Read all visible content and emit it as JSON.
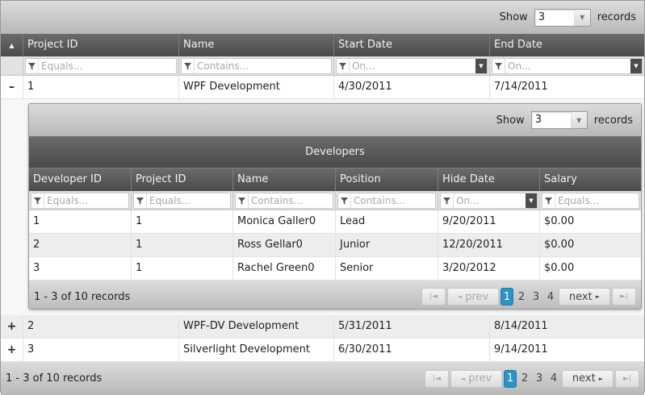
{
  "top_bar": {
    "show_label": "Show",
    "page_size": "3",
    "records_label": "records"
  },
  "columns": [
    "Project ID",
    "Name",
    "Start Date",
    "End Date"
  ],
  "filters": [
    "Equals...",
    "Contains...",
    "On...",
    "On..."
  ],
  "rows": [
    {
      "toggle": "–",
      "id": "1",
      "name": "WPF Development",
      "start": "4/30/2011",
      "end": "7/14/2011"
    },
    {
      "toggle": "+",
      "id": "2",
      "name": "WPF-DV Development",
      "start": "5/31/2011",
      "end": "8/14/2011"
    },
    {
      "toggle": "+",
      "id": "3",
      "name": "Silverlight Development",
      "start": "6/30/2011",
      "end": "9/14/2011"
    }
  ],
  "detail": {
    "show_label": "Show",
    "page_size": "3",
    "records_label": "records",
    "group_title": "Developers",
    "columns": [
      "Developer ID",
      "Project ID",
      "Name",
      "Position",
      "Hide Date",
      "Salary"
    ],
    "filters": [
      "Equals...",
      "Equals...",
      "Contains...",
      "Contains...",
      "On...",
      "Equals..."
    ],
    "rows": [
      [
        "1",
        "1",
        "Monica Galler0",
        "Lead",
        "9/20/2011",
        "$0.00"
      ],
      [
        "2",
        "1",
        "Ross Gellar0",
        "Junior",
        "12/20/2011",
        "$0.00"
      ],
      [
        "3",
        "1",
        "Rachel Green0",
        "Senior",
        "3/20/2012",
        "$0.00"
      ]
    ],
    "pager": {
      "summary": "1 - 3 of 10 records",
      "prev": "prev",
      "next": "next",
      "pages": [
        "1",
        "2",
        "3",
        "4"
      ],
      "active": "1"
    }
  },
  "pager": {
    "summary": "1 - 3 of 10 records",
    "prev": "prev",
    "next": "next",
    "pages": [
      "1",
      "2",
      "3",
      "4"
    ],
    "active": "1"
  },
  "colors": {
    "header": "#555555",
    "active_page": "#2b93c7"
  }
}
